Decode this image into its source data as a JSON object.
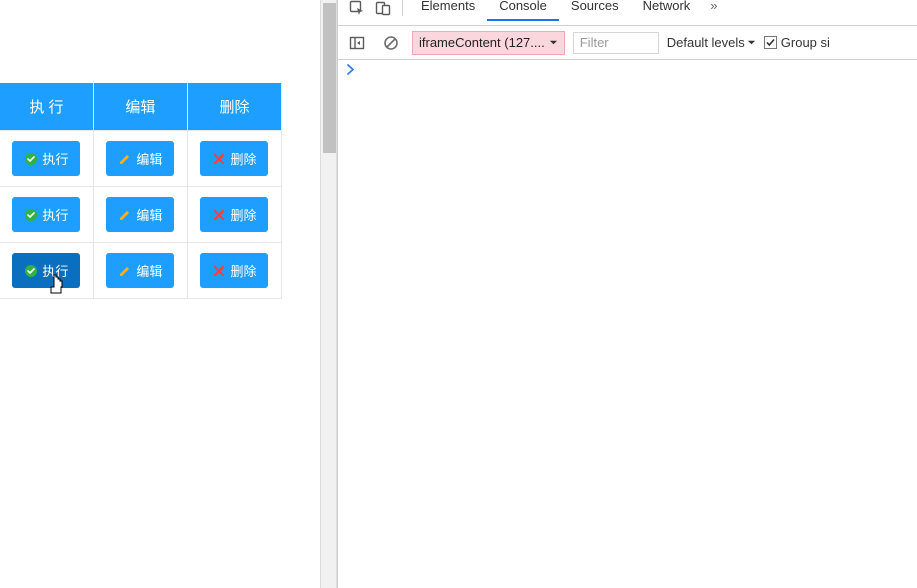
{
  "table": {
    "headers": {
      "execute": "执 行",
      "edit": "编辑",
      "delete": "删除"
    },
    "btn": {
      "execute": "执行",
      "edit": "编辑",
      "delete": "删除"
    },
    "rows": 3,
    "activeRowIndex": 2
  },
  "devtools": {
    "tabs": {
      "elements": "Elements",
      "console": "Console",
      "sources": "Sources",
      "network": "Network"
    },
    "more": "»",
    "toolbar": {
      "context": "iframeContent (127....",
      "filterPlaceholder": "Filter",
      "levels": "Default levels",
      "group": "Group si"
    },
    "prompt": ">"
  }
}
